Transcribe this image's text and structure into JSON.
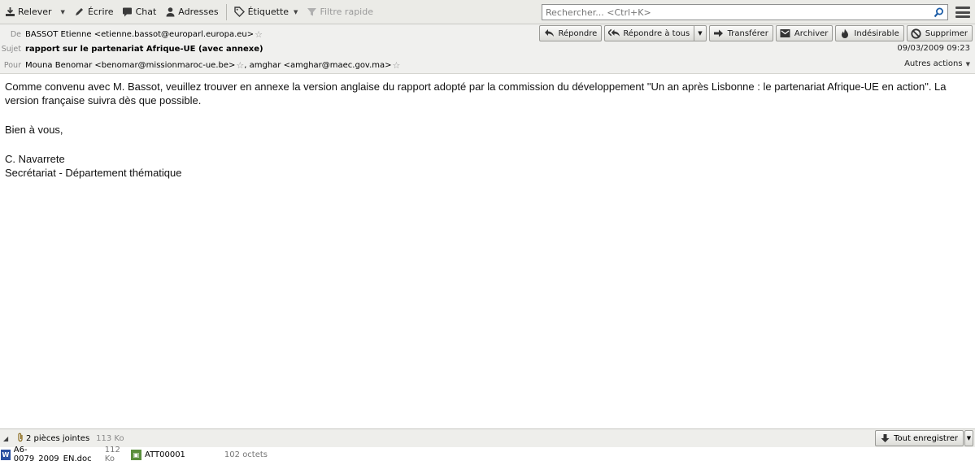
{
  "toolbar": {
    "get_mail": "Relever",
    "write": "Écrire",
    "chat": "Chat",
    "address_book": "Adresses",
    "tag": "Étiquette",
    "quick_filter": "Filtre rapide",
    "search_placeholder": "Rechercher... <Ctrl+K>"
  },
  "header": {
    "from_label": "De",
    "from": "BASSOT Etienne <etienne.bassot@europarl.europa.eu>",
    "subject_label": "Sujet",
    "subject": "rapport sur le partenariat Afrique-UE (avec annexe)",
    "to_label": "Pour",
    "to_1": "Mouna Benomar <benomar@missionmaroc-ue.be>",
    "to_sep": ", ",
    "to_2": "amghar <amghar@maec.gov.ma>",
    "date": "09/03/2009 09:23",
    "other_actions": "Autres actions",
    "buttons": {
      "reply": "Répondre",
      "reply_all": "Répondre à tous",
      "forward": "Transférer",
      "archive": "Archiver",
      "junk": "Indésirable",
      "delete": "Supprimer"
    }
  },
  "message": {
    "para1": "Comme convenu avec M. Bassot, veuillez trouver en annexe la version anglaise du rapport adopté par la commission du développement \"Un an après Lisbonne : le partenariat Afrique-UE en action\". La version française suivra dès que possible.",
    "greeting": "Bien à vous,",
    "sig_name": "C. Navarrete",
    "sig_dept": "Secrétariat - Département thématique"
  },
  "attachments": {
    "count_label": "2 pièces jointes",
    "total_size": "113 Ko",
    "save_all": "Tout enregistrer",
    "files": [
      {
        "name": "A6-0079_2009_EN.doc",
        "size": "112 Ko",
        "icon": "word-doc-icon"
      },
      {
        "name": "ATT00001",
        "size": "102 octets",
        "icon": "attachment-file-icon"
      }
    ]
  }
}
